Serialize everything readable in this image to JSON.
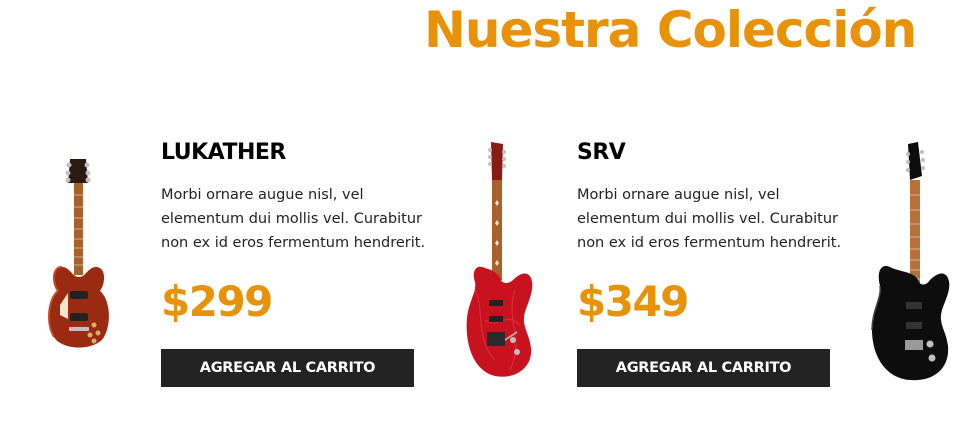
{
  "section": {
    "title": "Nuestra Colección"
  },
  "products": [
    {
      "name": "LUKATHER",
      "description": "Morbi ornare augue nisl, vel elementum dui mollis vel. Curabitur non ex id eros fermentum hendrerit.",
      "price": "$299",
      "button_label": "AGREGAR AL CARRITO",
      "image": "lespaul-guitar-red"
    },
    {
      "name": "SRV",
      "description": "Morbi ornare augue nisl, vel elementum dui mollis vel. Curabitur non ex id eros fermentum hendrerit.",
      "price": "$349",
      "button_label": "AGREGAR AL CARRITO",
      "image": "superstrat-guitar-red"
    },
    {
      "image": "superstrat-guitar-black"
    }
  ],
  "colors": {
    "accent": "#e8920a",
    "button": "#232323",
    "guitar1_body": "#9b2a12",
    "guitar2_body": "#c8121e",
    "guitar3_body": "#0d0d0d",
    "neck": "#a8612a"
  }
}
